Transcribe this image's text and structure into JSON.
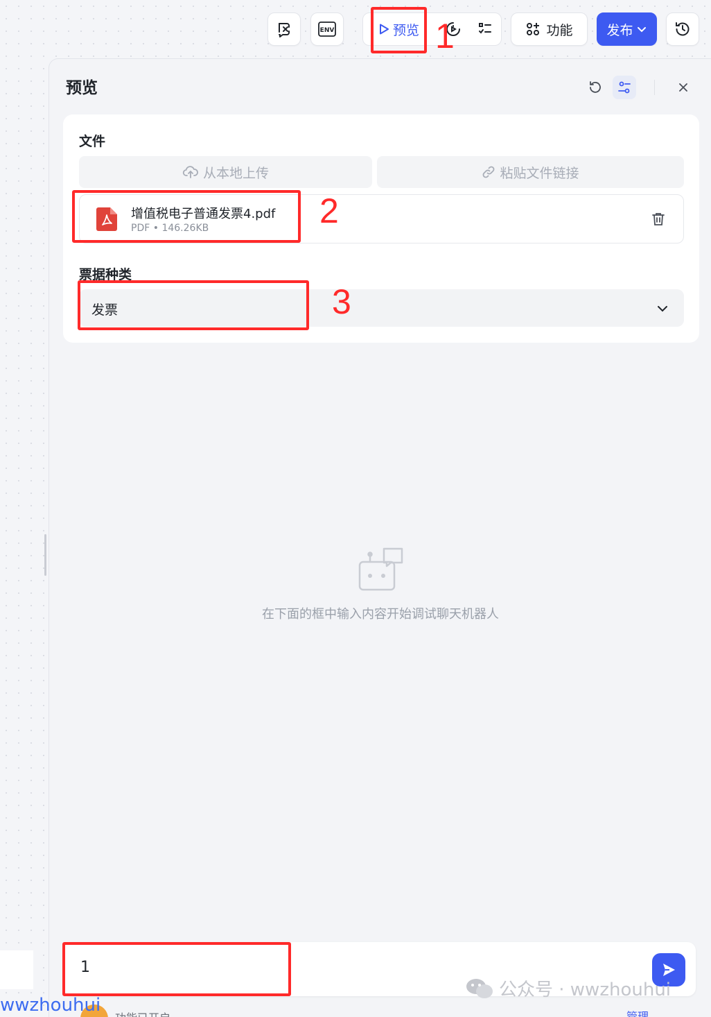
{
  "toolbar": {
    "preview_label": "预览",
    "features_label": "功能",
    "publish_label": "发布",
    "icons": [
      "variable-icon",
      "env-icon",
      "play-icon",
      "test-run-icon",
      "checklist-icon",
      "apps-icon",
      "chevron-down-icon",
      "history-icon"
    ]
  },
  "panel": {
    "title": "预览",
    "file_section": {
      "label": "文件",
      "upload_local": "从本地上传",
      "paste_link": "粘贴文件链接",
      "file": {
        "name": "增值税电子普通发票4.pdf",
        "type": "PDF",
        "separator": "•",
        "size": "146.26KB"
      }
    },
    "ticket_type": {
      "label": "票据种类",
      "value": "发票"
    },
    "empty_hint": "在下面的框中输入内容开始调试聊天机器人"
  },
  "chat": {
    "input_value": "1"
  },
  "annotations": {
    "markers": [
      "1",
      "2",
      "3"
    ]
  },
  "watermark": {
    "text": "公众号 · wwzhouhui",
    "left_text": "wwzhouhui"
  },
  "footer": {
    "status": "功能已开启",
    "manage": "管理"
  },
  "colors": {
    "accent": "#3d5af1",
    "annotation": "#ff2a2a",
    "pdf": "#e0433a"
  }
}
